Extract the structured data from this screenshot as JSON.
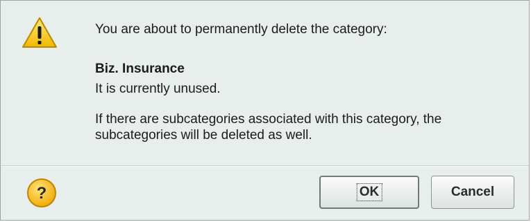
{
  "dialog": {
    "message_line1": "You are about to permanently delete the category:",
    "category_name": "Biz. Insurance",
    "status_line": "It is currently unused.",
    "warning_note": "If there are subcategories associated with this category, the subcategories will be deleted as well.",
    "icon": "warning-icon",
    "help_icon": "help-icon"
  },
  "buttons": {
    "ok_label": "OK",
    "cancel_label": "Cancel"
  },
  "colors": {
    "dialog_background": "#e8eeec",
    "warning_yellow": "#f5c400",
    "help_yellow": "#f4b400"
  }
}
